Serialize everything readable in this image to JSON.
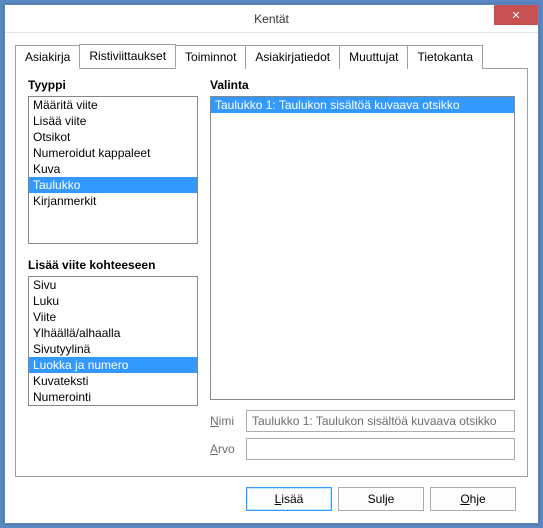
{
  "window": {
    "title": "Kentät"
  },
  "tabs": {
    "items": [
      {
        "label": "Asiakirja"
      },
      {
        "label": "Ristiviittaukset"
      },
      {
        "label": "Toiminnot"
      },
      {
        "label": "Asiakirjatiedot"
      },
      {
        "label": "Muuttujat"
      },
      {
        "label": "Tietokanta"
      }
    ],
    "active_index": 1
  },
  "type_group": {
    "label": "Tyyppi",
    "items": [
      "Määritä viite",
      "Lisää viite",
      "Otsikot",
      "Numeroidut kappaleet",
      "Kuva",
      "Taulukko",
      "Kirjanmerkit"
    ],
    "selected_index": 5
  },
  "insert_ref_group": {
    "label": "Lisää viite kohteeseen",
    "items": [
      "Sivu",
      "Luku",
      "Viite",
      "Ylhäällä/alhaalla",
      "Sivutyylinä",
      "Luokka ja numero",
      "Kuvateksti",
      "Numerointi"
    ],
    "selected_index": 5
  },
  "selection_group": {
    "label": "Valinta",
    "items": [
      "Taulukko 1: Taulukon sisältöä kuvaava otsikko"
    ],
    "selected_index": 0
  },
  "fields": {
    "name_label": "Nimi",
    "name_value": "Taulukko 1: Taulukon sisältöä kuvaava otsikko",
    "value_label": "Arvo",
    "value_value": ""
  },
  "buttons": {
    "insert": "Lisää",
    "close": "Sulje",
    "help": "Ohje"
  }
}
